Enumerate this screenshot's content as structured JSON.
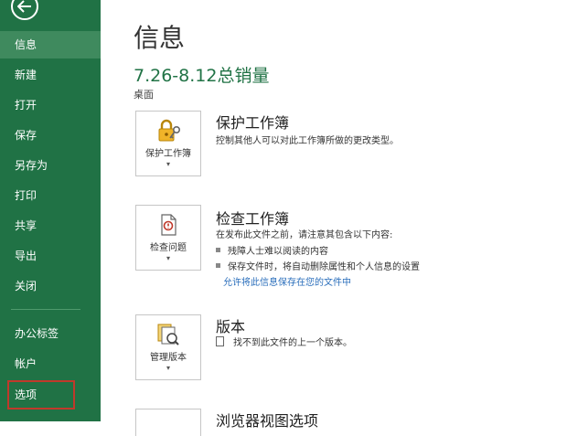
{
  "sidebar": {
    "back_icon": "back-arrow-icon",
    "items": [
      {
        "label": "信息"
      },
      {
        "label": "新建"
      },
      {
        "label": "打开"
      },
      {
        "label": "保存"
      },
      {
        "label": "另存为"
      },
      {
        "label": "打印"
      },
      {
        "label": "共享"
      },
      {
        "label": "导出"
      },
      {
        "label": "关闭"
      },
      {
        "label": "办公标签"
      },
      {
        "label": "帐户"
      },
      {
        "label": "选项"
      }
    ],
    "active_index": 0,
    "highlighted_index": 11
  },
  "main": {
    "title": "信息",
    "doc_name": "7.26-8.12总销量",
    "doc_location": "桌面",
    "protect": {
      "tile_label": "保护工作簿",
      "icon": "lock-key-icon",
      "title": "保护工作簿",
      "desc": "控制其他人可以对此工作簿所做的更改类型。"
    },
    "inspect": {
      "tile_label": "检查问题",
      "icon": "document-check-icon",
      "title": "检查工作簿",
      "desc": "在发布此文件之前，请注意其包含以下内容:",
      "bullets": [
        "残障人士难以阅读的内容",
        "保存文件时，将自动删除属性和个人信息的设置"
      ],
      "link": "允许将此信息保存在您的文件中"
    },
    "versions": {
      "tile_label": "管理版本",
      "icon": "version-history-icon",
      "title": "版本",
      "desc": "找不到此文件的上一个版本。"
    },
    "browser": {
      "title": "浏览器视图选项"
    }
  },
  "colors": {
    "sidebar_bg": "#207245",
    "sidebar_active": "#3f8a5e",
    "accent_green": "#217346",
    "highlight_border": "#c0392b",
    "link": "#2a6ebb"
  }
}
